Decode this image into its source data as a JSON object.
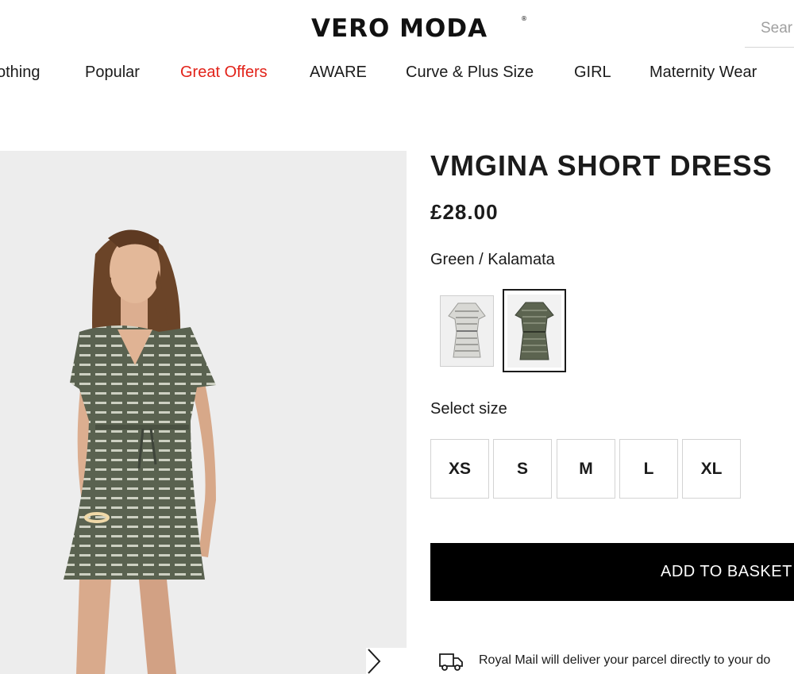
{
  "header": {
    "logo": "VERO MODA",
    "logo_mark": "®",
    "search_placeholder": "Sear"
  },
  "nav": {
    "items": [
      {
        "label": "othing"
      },
      {
        "label": "Popular"
      },
      {
        "label": "Great Offers",
        "highlight": "#e2231a"
      },
      {
        "label": "AWARE"
      },
      {
        "label": "Curve & Plus Size"
      },
      {
        "label": "GIRL"
      },
      {
        "label": "Maternity Wear"
      }
    ]
  },
  "gallery": {
    "next_icon": "chevron-right-icon"
  },
  "product": {
    "title": "VMGINA SHORT DRESS",
    "price": "£28.00",
    "color_name": "Green / Kalamata",
    "swatches": [
      {
        "name": "white-stripe",
        "color": "#cfcfcb"
      },
      {
        "name": "green-kalamata",
        "color": "#5c6450",
        "selected": true
      }
    ],
    "size_label": "Select size",
    "sizes": [
      "XS",
      "S",
      "M",
      "L",
      "XL"
    ],
    "add_to_basket": "ADD TO BASKET",
    "delivery_icon": "truck-icon",
    "delivery_text": "Royal Mail will deliver your parcel directly to your do"
  },
  "colors": {
    "accent_offer": "#e2231a",
    "button_bg": "#000000",
    "dress_green": "#5c6450"
  }
}
